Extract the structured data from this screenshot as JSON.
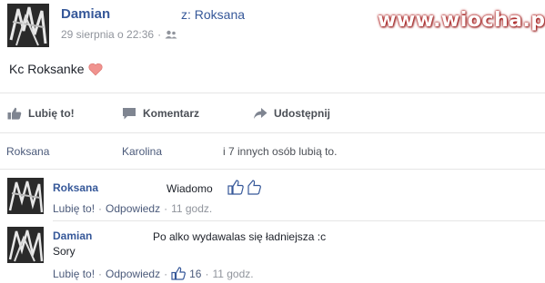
{
  "watermark": "www.wiocha.pl",
  "post": {
    "author": "Damian",
    "recipient": "z: Roksana",
    "timestamp": "29 sierpnia o 22:36",
    "separator": "·",
    "audience_icon": "friends-icon",
    "text": "Kc Roksanke",
    "emoji": "heart-icon"
  },
  "actions": {
    "like": "Lubię to!",
    "comment": "Komentarz",
    "share": "Udostępnij"
  },
  "likers": {
    "first": "Roksana",
    "second": "Karolina",
    "rest": "i 7 innych osób lubią to."
  },
  "comments": [
    {
      "author": "Roksana",
      "text": "Wiadomo",
      "like_label": "Lubię to!",
      "separator": "·",
      "reply_label": "Odpowiedz",
      "time": "11 godz."
    },
    {
      "author": "Damian",
      "text": "Po alko wydawalas się ładniejsza :c",
      "text2": "Sory",
      "like_label": "Lubię to!",
      "separator": "·",
      "reply_label": "Odpowiedz",
      "reaction_count": "16",
      "time": "11 godz."
    }
  ],
  "colors": {
    "link_blue": "#365899",
    "meta_gray": "#90949c",
    "heart": "#f0938f",
    "watermark_outline": "#b02020"
  }
}
